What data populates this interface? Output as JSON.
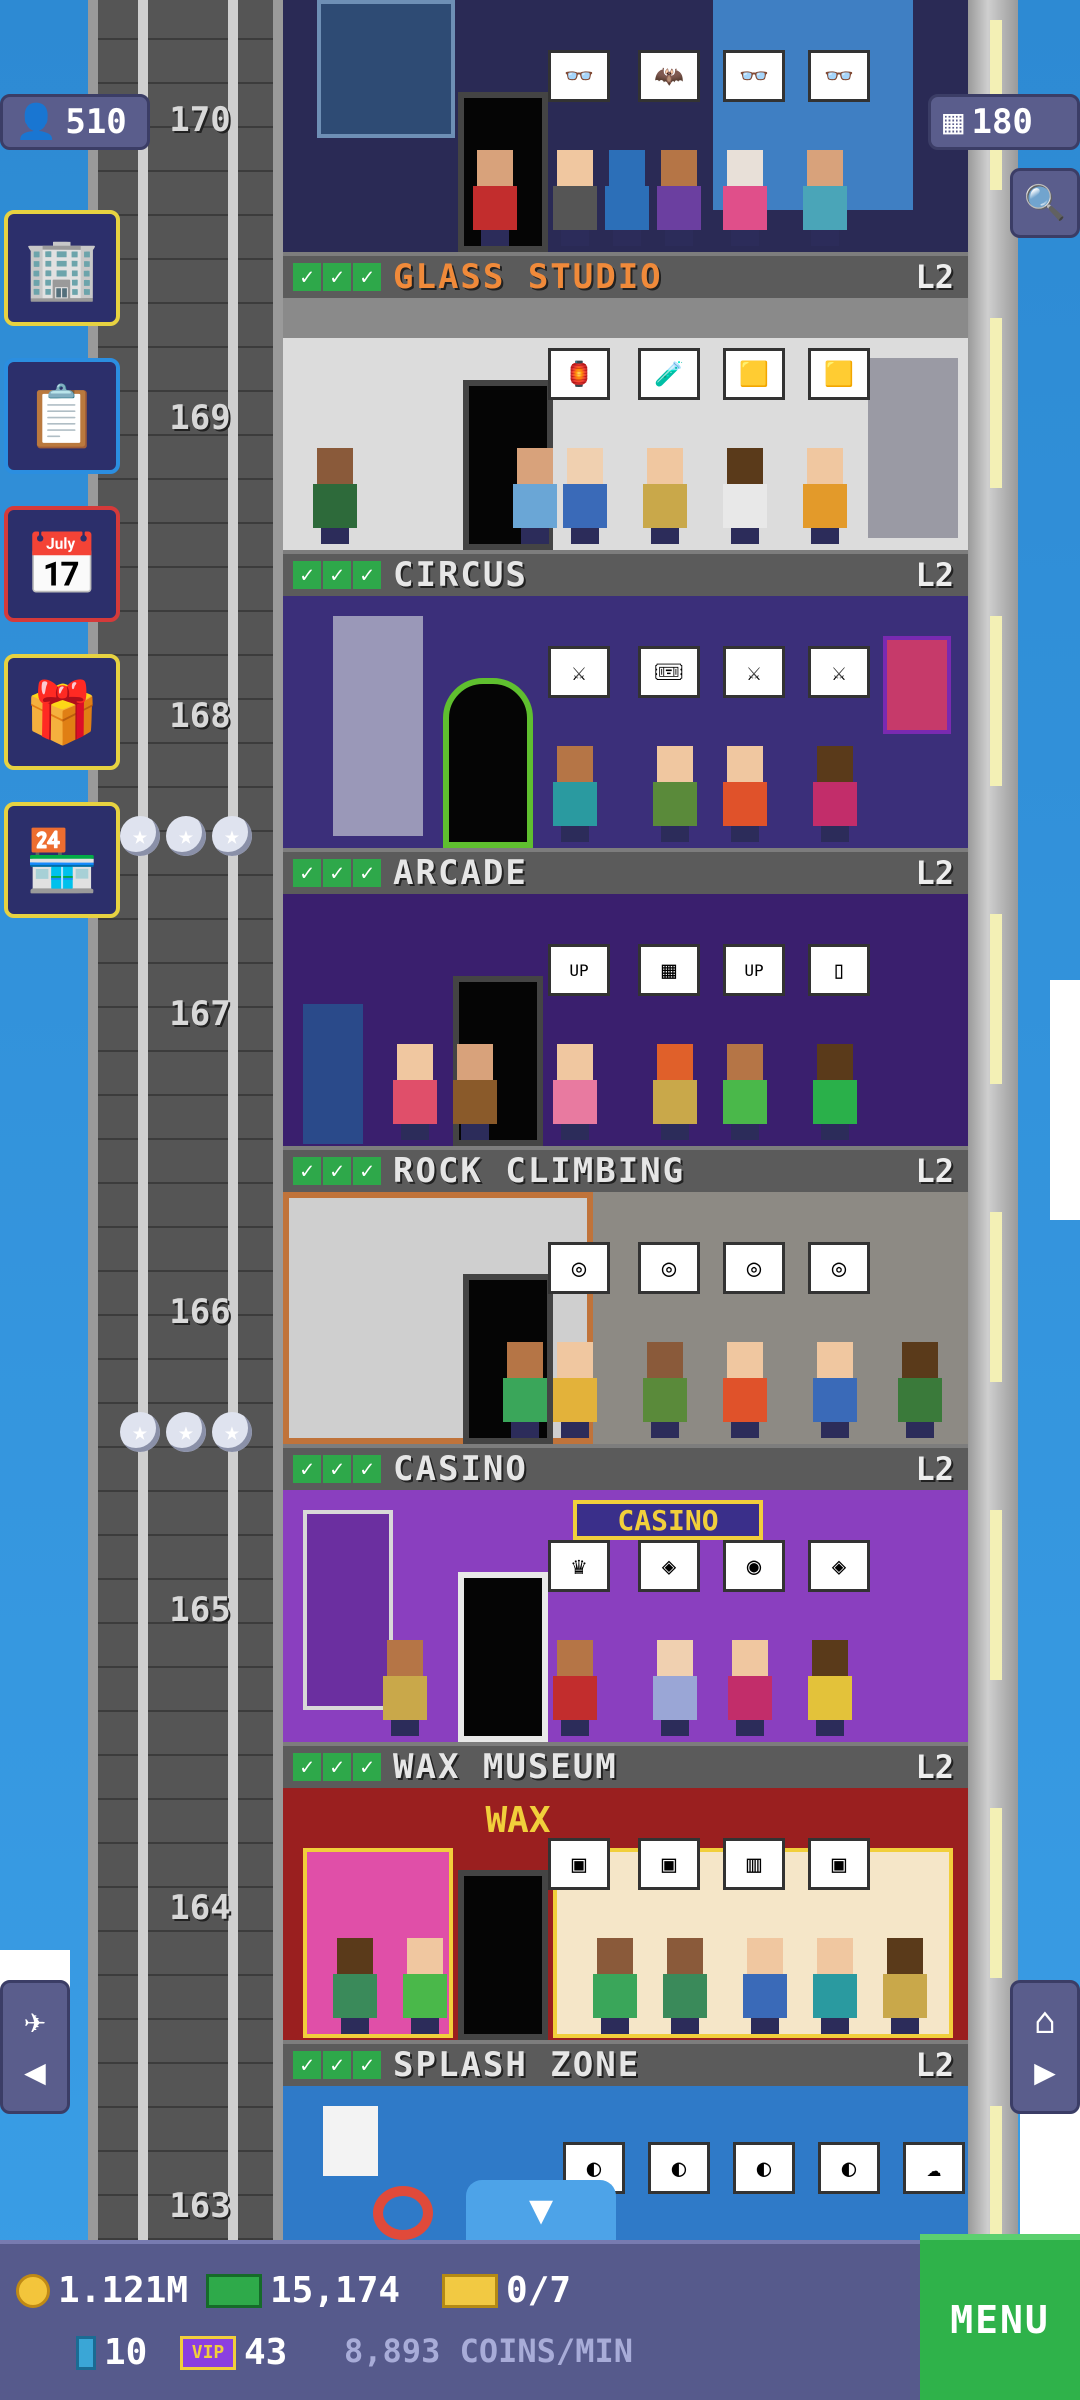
{
  "hud": {
    "population": "510",
    "floor_count": "180"
  },
  "floors": [
    {
      "number": "170",
      "name": "GLASS STUDIO",
      "level": "L2"
    },
    {
      "number": "169",
      "name": "CIRCUS",
      "level": "L2"
    },
    {
      "number": "168",
      "name": "ARCADE",
      "level": "L2"
    },
    {
      "number": "167",
      "name": "ROCK CLIMBING",
      "level": "L2"
    },
    {
      "number": "166",
      "name": "CASINO",
      "level": "L2"
    },
    {
      "number": "165",
      "name": "WAX MUSEUM",
      "level": "L2"
    },
    {
      "number": "164",
      "name": "SPLASH ZONE",
      "level": "L2"
    },
    {
      "number": "163"
    }
  ],
  "room_signs": {
    "casino": "CASINO",
    "wax": "WAX"
  },
  "side_buttons": [
    "build-icon",
    "missions-icon",
    "calendar-icon",
    "gift-icon",
    "market-stall-icon"
  ],
  "bottom_bar": {
    "coins": "1.121M",
    "bux": "15,174",
    "tickets": "0/7",
    "gems": "10",
    "vip": "43",
    "rate": "8,893 COINS/MIN",
    "menu_label": "MENU"
  },
  "colors": {
    "sky": "#2f8ed6",
    "hud_panel": "#5a5d8c",
    "menu": "#2fb24a",
    "check": "#2ea84a"
  }
}
